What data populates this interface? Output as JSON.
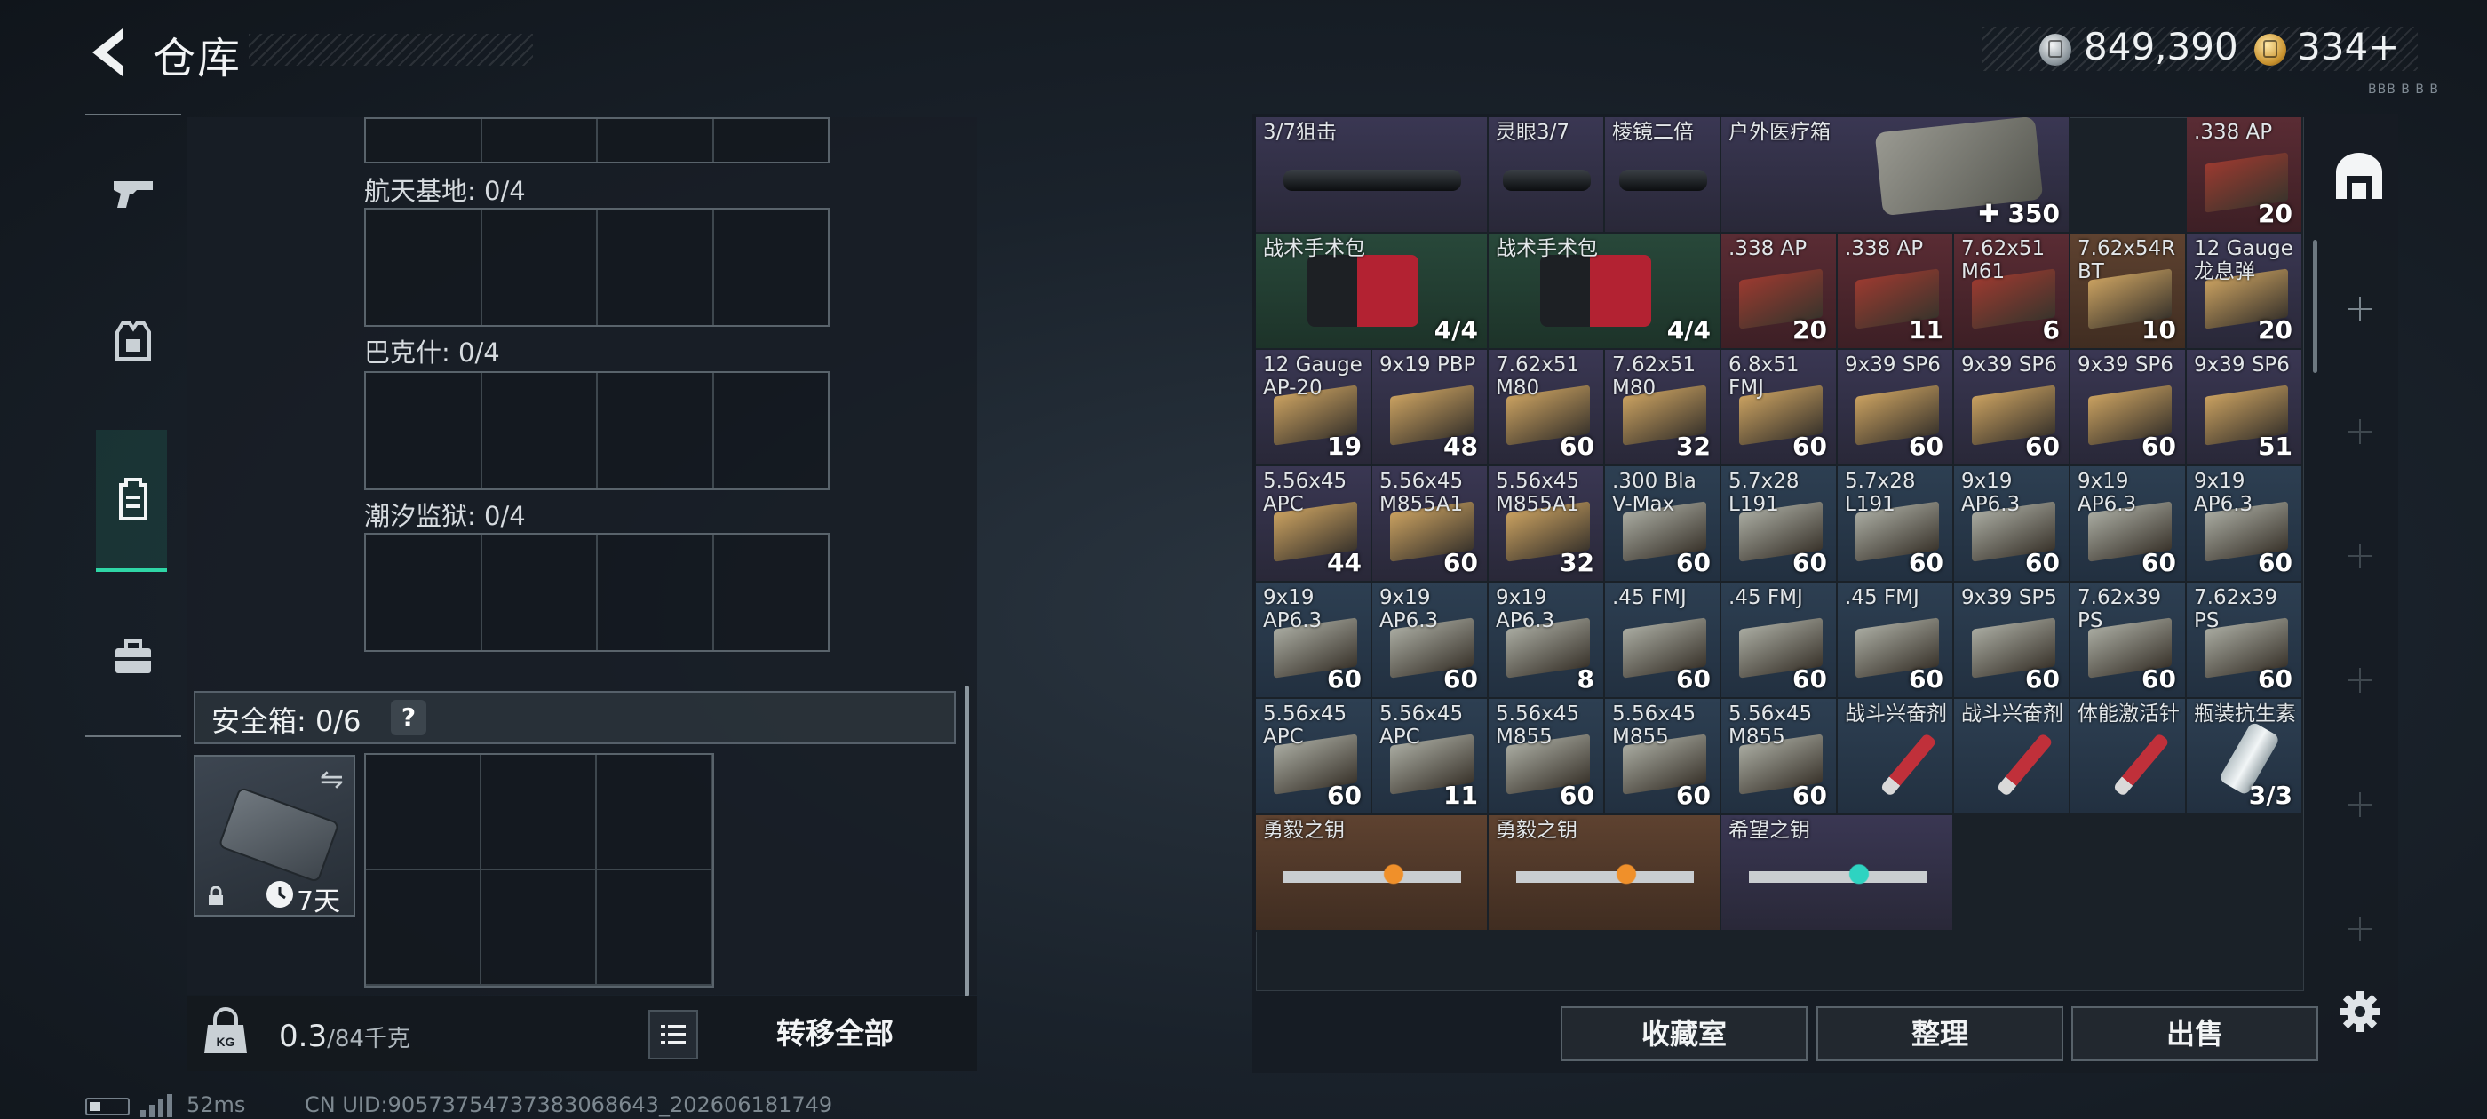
{
  "header": {
    "title": "仓库"
  },
  "currency": {
    "silver": "849,390",
    "gold": "334",
    "gold_add": "+",
    "tiny_label": "BBB B B B"
  },
  "sidebar": {
    "tabs": [
      {
        "name": "weapons"
      },
      {
        "name": "armor"
      },
      {
        "name": "backpack"
      },
      {
        "name": "toolbox"
      }
    ],
    "active_index": 2
  },
  "zones": [
    {
      "label": "航天基地: 0/4"
    },
    {
      "label": "巴克什: 0/4"
    },
    {
      "label": "潮汐监狱: 0/4"
    }
  ],
  "safe_box": {
    "label": "安全箱: 0/6",
    "help": "?",
    "duration": "7天"
  },
  "weight": {
    "current": "0.3",
    "capacity": "/84千克"
  },
  "transfer_all": "转移全部",
  "inventory": [
    {
      "name": "3/7狙击",
      "count": "",
      "color": "purple"
    },
    {
      "name": "灵眼3/7",
      "count": "",
      "color": "purple"
    },
    {
      "name": "棱镜二倍",
      "count": "",
      "color": "purple"
    },
    {
      "name": "户外医疗箱",
      "count": "350",
      "color": "purple"
    },
    {
      "name": ".338 AP",
      "count": "20",
      "color": "red"
    },
    {
      "name": "战术手术包",
      "count": "4/4",
      "color": "green"
    },
    {
      "name": "战术手术包",
      "count": "4/4",
      "color": "green"
    },
    {
      "name": ".338 AP",
      "count": "20",
      "color": "red"
    },
    {
      "name": ".338 AP",
      "count": "11",
      "color": "red"
    },
    {
      "name": "7.62x51 M61",
      "count": "6",
      "color": "red"
    },
    {
      "name": "7.62x54R BT",
      "count": "10",
      "color": "gold"
    },
    {
      "name": "12 Gauge 龙息弹",
      "count": "20",
      "color": "purple"
    },
    {
      "name": "12 Gauge AP-20",
      "count": "19",
      "color": "purple"
    },
    {
      "name": "9x19 PBP",
      "count": "48",
      "color": "purple"
    },
    {
      "name": "7.62x51 M80",
      "count": "60",
      "color": "purple"
    },
    {
      "name": "7.62x51 M80",
      "count": "32",
      "color": "purple"
    },
    {
      "name": "6.8x51 FMJ",
      "count": "60",
      "color": "purple"
    },
    {
      "name": "9x39 SP6",
      "count": "60",
      "color": "purple"
    },
    {
      "name": "9x39 SP6",
      "count": "60",
      "color": "purple"
    },
    {
      "name": "9x39 SP6",
      "count": "60",
      "color": "purple"
    },
    {
      "name": "9x39 SP6",
      "count": "51",
      "color": "purple"
    },
    {
      "name": "5.56x45 APC",
      "count": "44",
      "color": "purple"
    },
    {
      "name": "5.56x45 M855A1",
      "count": "60",
      "color": "purple"
    },
    {
      "name": "5.56x45 M855A1",
      "count": "32",
      "color": "purple"
    },
    {
      "name": ".300 Bla V-Max",
      "count": "60",
      "color": "blue"
    },
    {
      "name": "5.7x28 L191",
      "count": "60",
      "color": "blue"
    },
    {
      "name": "5.7x28 L191",
      "count": "60",
      "color": "blue"
    },
    {
      "name": "9x19 AP6.3",
      "count": "60",
      "color": "blue"
    },
    {
      "name": "9x19 AP6.3",
      "count": "60",
      "color": "blue"
    },
    {
      "name": "9x19 AP6.3",
      "count": "60",
      "color": "blue"
    },
    {
      "name": "9x19 AP6.3",
      "count": "60",
      "color": "blue"
    },
    {
      "name": "9x19 AP6.3",
      "count": "60",
      "color": "blue"
    },
    {
      "name": "9x19 AP6.3",
      "count": "8",
      "color": "blue"
    },
    {
      "name": ".45 FMJ",
      "count": "60",
      "color": "blue"
    },
    {
      "name": ".45 FMJ",
      "count": "60",
      "color": "blue"
    },
    {
      "name": ".45 FMJ",
      "count": "60",
      "color": "blue"
    },
    {
      "name": "9x39 SP5",
      "count": "60",
      "color": "blue"
    },
    {
      "name": "7.62x39 PS",
      "count": "60",
      "color": "blue"
    },
    {
      "name": "7.62x39 PS",
      "count": "60",
      "color": "blue"
    },
    {
      "name": "5.56x45 APC",
      "count": "60",
      "color": "blue"
    },
    {
      "name": "5.56x45 APC",
      "count": "11",
      "color": "blue"
    },
    {
      "name": "5.56x45 M855",
      "count": "60",
      "color": "blue"
    },
    {
      "name": "5.56x45 M855",
      "count": "60",
      "color": "blue"
    },
    {
      "name": "5.56x45 M855",
      "count": "60",
      "color": "blue"
    },
    {
      "name": "战斗兴奋剂",
      "count": "",
      "color": "blue"
    },
    {
      "name": "战斗兴奋剂",
      "count": "",
      "color": "blue"
    },
    {
      "name": "体能激活针",
      "count": "",
      "color": "blue"
    },
    {
      "name": "瓶装抗生素",
      "count": "3/3",
      "color": "blue"
    },
    {
      "name": "勇毅之钥",
      "count": "",
      "color": "gold"
    },
    {
      "name": "勇毅之钥",
      "count": "",
      "color": "gold"
    },
    {
      "name": "希望之钥",
      "count": "",
      "color": "purple"
    }
  ],
  "buttons": {
    "collection": "收藏室",
    "sort": "整理",
    "sell": "出售"
  },
  "status": {
    "ping": "52ms",
    "uid": "CN UID:905737547373830686​43_202606181749"
  },
  "colors": {
    "accent": "#2fd6a6",
    "purple": "#3a3753",
    "green": "#28483a",
    "red": "#5a2c34",
    "blue": "#2d3f52",
    "gold": "#5e4230"
  }
}
